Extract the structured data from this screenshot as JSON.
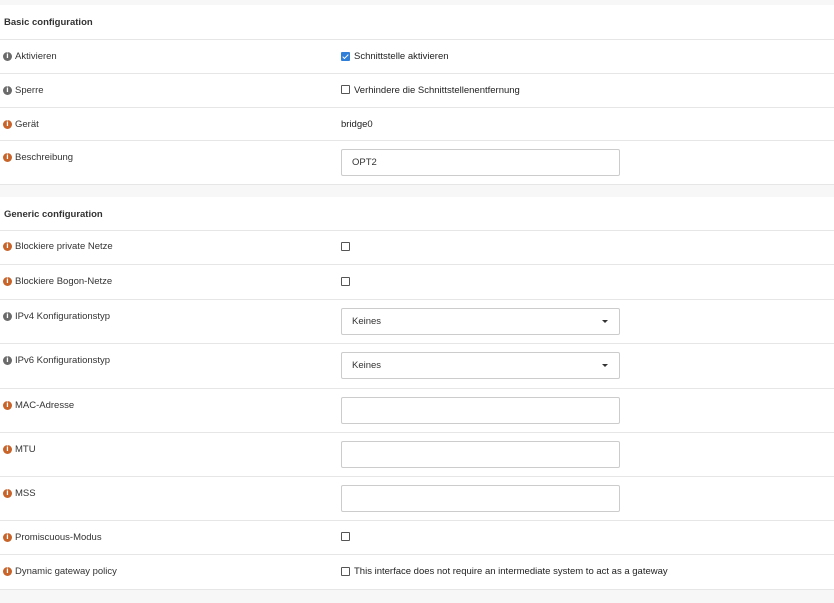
{
  "basic": {
    "title": "Basic configuration",
    "enable": {
      "label": "Aktivieren",
      "checked": true,
      "text": "Schnittstelle aktivieren"
    },
    "lock": {
      "label": "Sperre",
      "checked": false,
      "text": "Verhindere die Schnittstellenentfernung"
    },
    "device": {
      "label": "Gerät",
      "value": "bridge0"
    },
    "description": {
      "label": "Beschreibung",
      "value": "OPT2"
    }
  },
  "generic": {
    "title": "Generic configuration",
    "block_private": {
      "label": "Blockiere private Netze",
      "checked": false
    },
    "block_bogon": {
      "label": "Blockiere Bogon-Netze",
      "checked": false
    },
    "ipv4_type": {
      "label": "IPv4 Konfigurationstyp",
      "value": "Keines"
    },
    "ipv6_type": {
      "label": "IPv6 Konfigurationstyp",
      "value": "Keines"
    },
    "mac": {
      "label": "MAC-Adresse",
      "value": ""
    },
    "mtu": {
      "label": "MTU",
      "value": ""
    },
    "mss": {
      "label": "MSS",
      "value": ""
    },
    "promisc": {
      "label": "Promiscuous-Modus",
      "checked": false
    },
    "gateway_policy": {
      "label": "Dynamic gateway policy",
      "checked": false,
      "text": "This interface does not require an intermediate system to act as a gateway"
    }
  },
  "colors": {
    "info_grey": "#6b6b6b",
    "info_orange": "#c8642a",
    "checkbox_checked": "#2f7ed8"
  }
}
